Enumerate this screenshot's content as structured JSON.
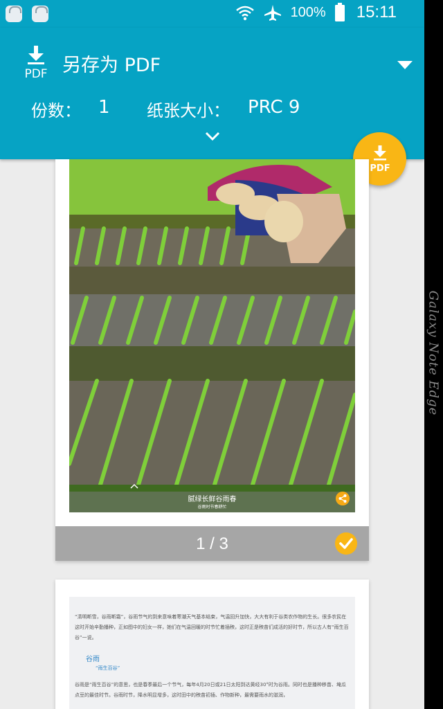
{
  "status_bar": {
    "battery_percent": "100%",
    "time": "15:11",
    "app_icon_label": "Galaxy",
    "icons": [
      "galaxy-apps-icon",
      "galaxy-apps-icon",
      "wifi-icon",
      "airplane-mode-icon",
      "battery-icon"
    ]
  },
  "device": {
    "edge_label": "Galaxy Note Edge"
  },
  "header": {
    "printer_name": "另存为 PDF",
    "copies_label": "份数：",
    "copies_value": "1",
    "paper_size_label": "纸张大小：",
    "paper_size_value": "PRC 9",
    "printer_icon_text": "PDF"
  },
  "fab": {
    "label": "PDF"
  },
  "preview": {
    "page1": {
      "caption_title": "腻绿长鲜谷雨春",
      "caption_subtitle": "谷雨时节春耕忙",
      "page_indicator": "1 / 3",
      "selected": true
    },
    "page2": {
      "paragraph1": "“清明断雪，谷雨断霜”，谷雨节气的到来意味着寒潮天气基本结束，气温回升加快，大大有利于谷类农作物的生长。很多农民在这时开始辛勤播种，正如图中的妇女一样，她们在气温回暖的时节忙着插秧，这时正是秧苗们成活的好时节，所以古人有“雨生百谷”一说。",
      "heading": "谷雨",
      "subheading": "“雨生百谷”",
      "paragraph2": "谷雨是“雨生百谷”的意思，也是春季最后一个节气，每年4月20日或21日太阳到达黄经30°时为谷雨。同时也是播种移苗、埯瓜点豆的最佳时节。谷雨时节，降水明显增多，这时田中的秧苗初插、作物新种，最需要雨水的滋润，"
    }
  },
  "colors": {
    "header_bg": "#06a3c4",
    "accent": "#f9b615",
    "page_footer": "#a6a6a6",
    "background": "#ececec",
    "doc_heading": "#2f86c7"
  }
}
